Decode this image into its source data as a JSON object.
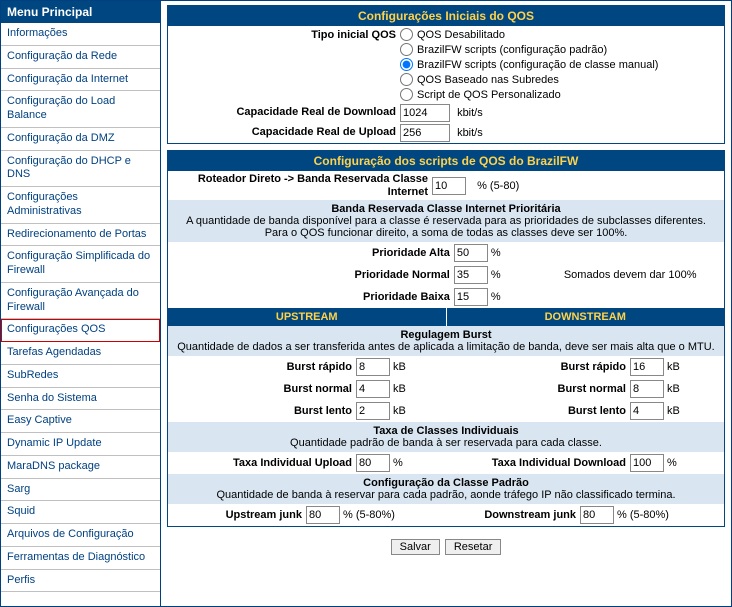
{
  "sidebar": {
    "title": "Menu Principal",
    "items": [
      "Informações",
      "Configuração da Rede",
      "Configuração da Internet",
      "Configuração do Load Balance",
      "Configuração da DMZ",
      "Configuração do DHCP e DNS",
      "Configurações Administrativas",
      "Redirecionamento de Portas",
      "Configuração Simplificada do Firewall",
      "Configuração Avançada do Firewall",
      "Configurações QOS",
      "Tarefas Agendadas",
      "SubRedes",
      "Senha do Sistema",
      "Easy Captive",
      "Dynamic IP Update",
      "MaraDNS package",
      "Sarg",
      "Squid",
      "Arquivos de Configuração",
      "Ferramentas de Diagnóstico",
      "Perfis"
    ],
    "highlight_index": 10
  },
  "initial": {
    "title": "Configurações Iniciais do QOS",
    "type_label": "Tipo inicial QOS",
    "options": [
      "QOS Desabilitado",
      "BrazilFW scripts (configuração padrão)",
      "BrazilFW scripts (configuração de classe manual)",
      "QOS Baseado nas Subredes",
      "Script de QOS Personalizado"
    ],
    "selected": 2,
    "download_label": "Capacidade Real de Download",
    "download_value": "1024",
    "upload_label": "Capacidade Real de Upload",
    "upload_value": "256",
    "kbit": "kbit/s"
  },
  "scripts": {
    "title": "Configuração dos scripts de QOS do BrazilFW",
    "router_label": "Roteador Direto -> Banda Reservada Classe Internet",
    "router_value": "10",
    "router_suffix": "% (5-80)",
    "reserved_title": "Banda Reservada Classe Internet Prioritária",
    "reserved_desc": "A quantidade de banda disponível para a classe é reservada para as prioridades de subclasses diferentes. Para o QOS funcionar direito, a soma de todas as classes deve ser 100%.",
    "pri_high_label": "Prioridade Alta",
    "pri_high_value": "50",
    "pri_normal_label": "Prioridade Normal",
    "pri_normal_value": "35",
    "pri_low_label": "Prioridade Baixa",
    "pri_low_value": "15",
    "pct": "%",
    "sum_note": "Somados devem dar 100%",
    "upstream": "UPSTREAM",
    "downstream": "DOWNSTREAM",
    "burst_title": "Regulagem Burst",
    "burst_desc": "Quantidade de dados a ser transferida antes de aplicada a limitação de banda, deve ser mais alta que o MTU.",
    "burst_fast": "Burst rápido",
    "burst_normal": "Burst normal",
    "burst_slow": "Burst lento",
    "burst_up_fast": "8",
    "burst_up_normal": "4",
    "burst_up_slow": "2",
    "burst_down_fast": "16",
    "burst_down_normal": "8",
    "burst_down_slow": "4",
    "kb": "kB",
    "indiv_title": "Taxa de Classes Individuais",
    "indiv_desc": "Quantidade padrão de banda à ser reservada para cada classe.",
    "indiv_up_label": "Taxa Individual Upload",
    "indiv_up_value": "80",
    "indiv_down_label": "Taxa Individual Download",
    "indiv_down_value": "100",
    "default_title": "Configuração da Classe Padrão",
    "default_desc": "Quantidade de banda à reservar para cada padrão, aonde tráfego IP não classificado termina.",
    "up_junk_label": "Upstream junk",
    "up_junk_value": "80",
    "down_junk_label": "Downstream junk",
    "down_junk_value": "80",
    "junk_suffix": "% (5-80%)"
  },
  "buttons": {
    "save": "Salvar",
    "reset": "Resetar"
  }
}
